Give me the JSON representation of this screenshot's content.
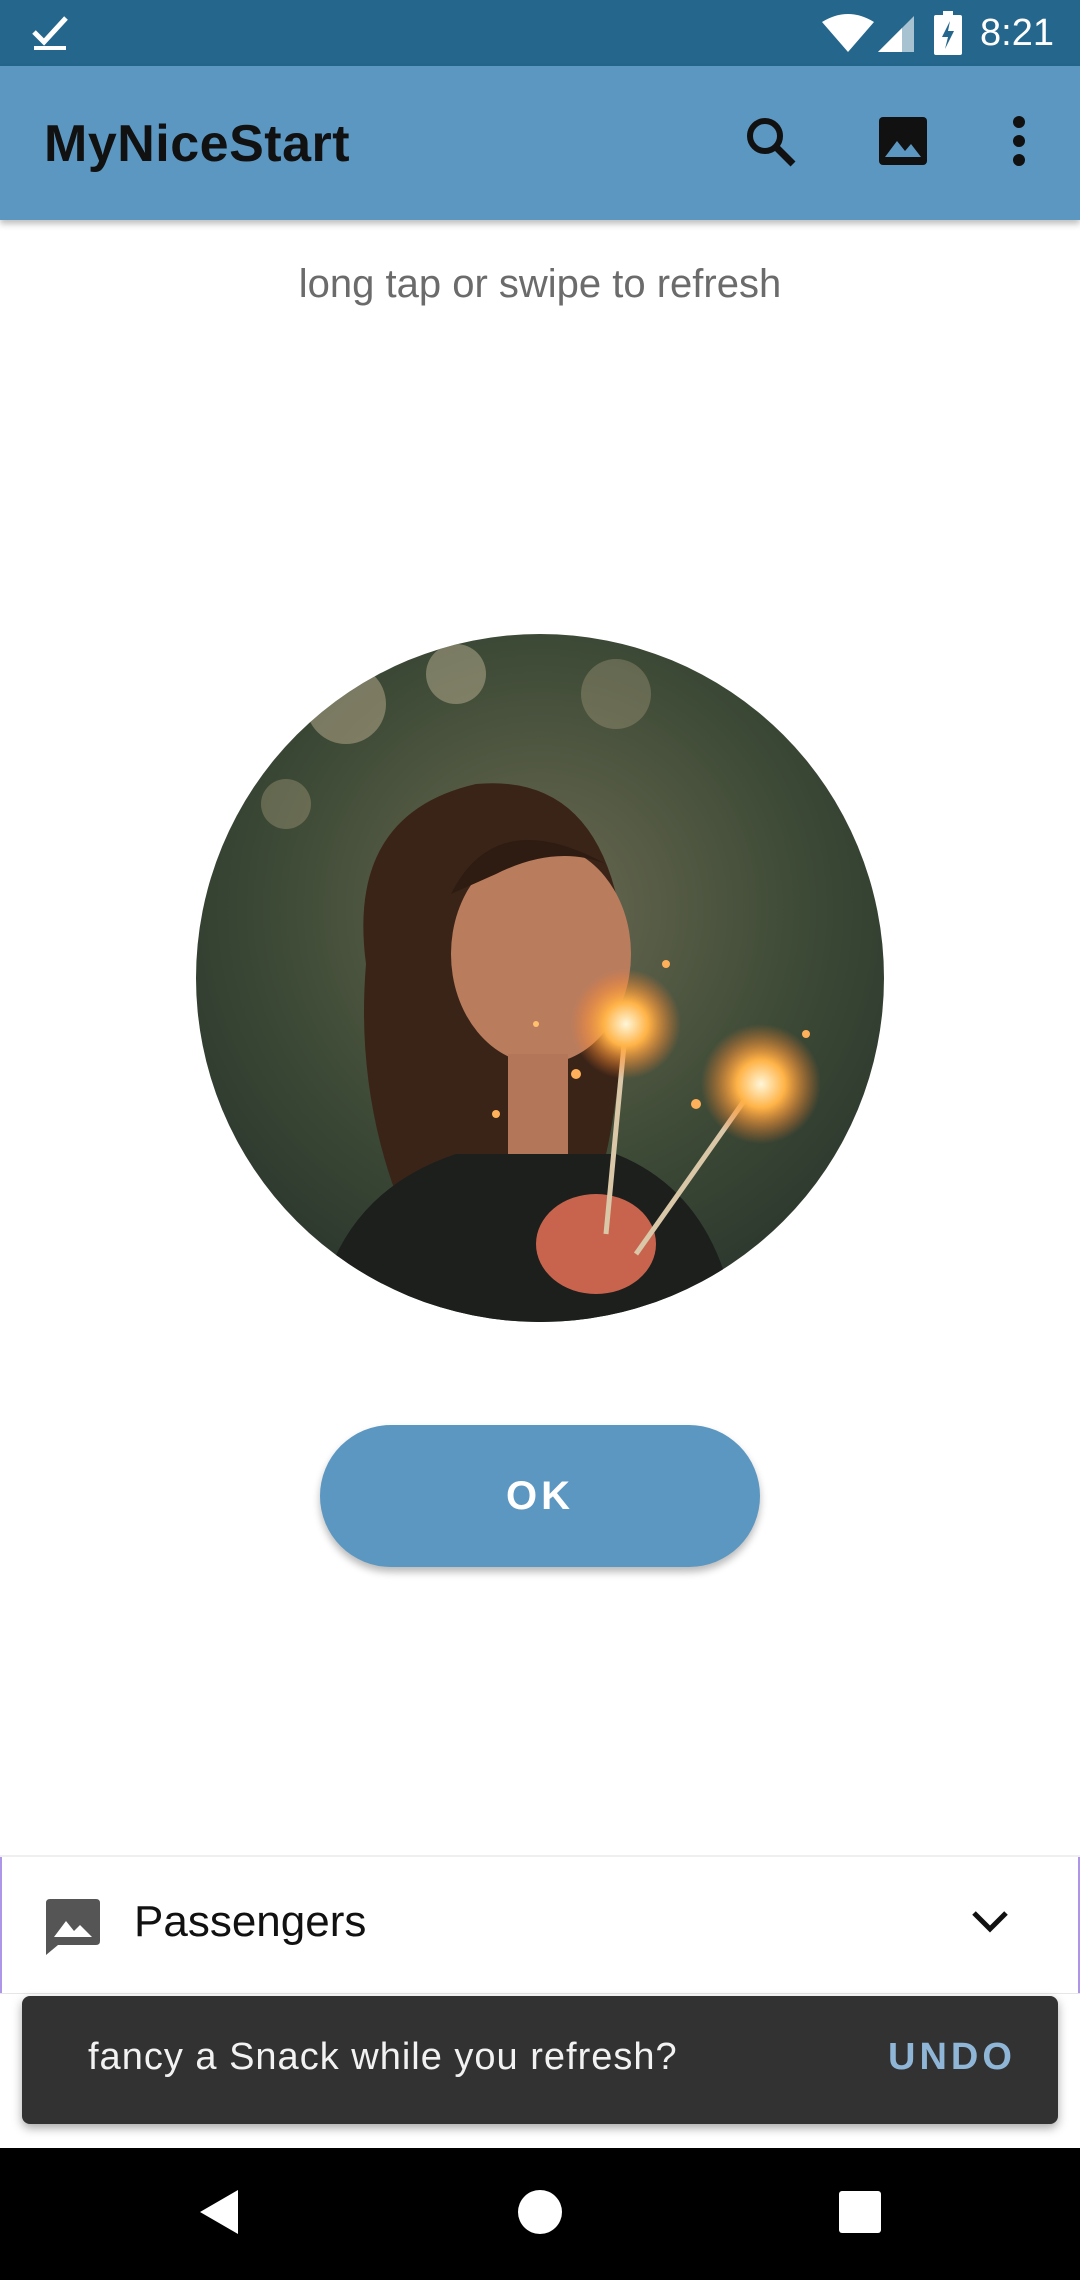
{
  "status_bar": {
    "time": "8:21",
    "icons": [
      "check-icon",
      "wifi-icon",
      "cell-signal-icon",
      "battery-charging-icon"
    ]
  },
  "app_bar": {
    "title": "MyNiceStart",
    "actions": [
      "search-icon",
      "image-icon",
      "more-vert-icon"
    ],
    "background_color": "#5b97c1"
  },
  "main": {
    "hint": "long tap or swipe to refresh",
    "photo_icon": "portrait-photo",
    "ok_label": "OK"
  },
  "spinner": {
    "icon": "image-icon",
    "selected": "Passengers",
    "chevron": "chevron-down-icon"
  },
  "snackbar": {
    "message": "fancy a Snack while you refresh?",
    "action": "UNDO"
  },
  "nav_bar": {
    "buttons": [
      "back-icon",
      "home-icon",
      "recents-icon"
    ]
  }
}
